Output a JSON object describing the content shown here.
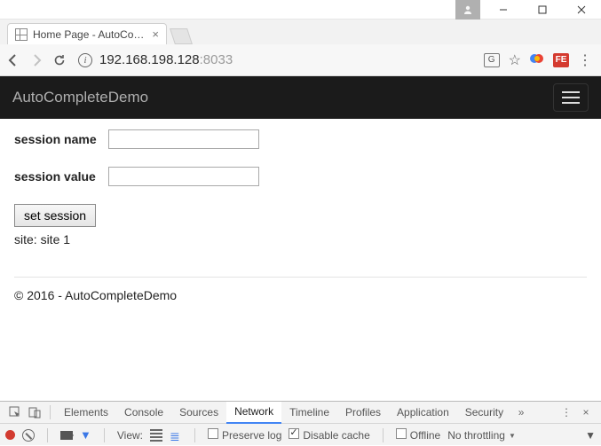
{
  "window": {
    "tab_title": "Home Page - AutoComp…",
    "url_host": "192.168.198.128",
    "url_port": ":8033",
    "translate_label": "G",
    "ext_flash_label": "FE"
  },
  "app": {
    "brand": "AutoCompleteDemo"
  },
  "form": {
    "session_name_label": "session name",
    "session_name_value": "",
    "session_value_label": "session value",
    "session_value_value": "",
    "button_label": "set session",
    "site_line": "site: site 1"
  },
  "footer": {
    "text": "© 2016 - AutoCompleteDemo"
  },
  "devtools": {
    "tabs": {
      "elements": "Elements",
      "console": "Console",
      "sources": "Sources",
      "network": "Network",
      "timeline": "Timeline",
      "profiles": "Profiles",
      "application": "Application",
      "security": "Security"
    },
    "toolbar": {
      "view_label": "View:",
      "preserve_log": "Preserve log",
      "disable_cache": "Disable cache",
      "offline": "Offline",
      "throttling": "No throttling"
    }
  }
}
